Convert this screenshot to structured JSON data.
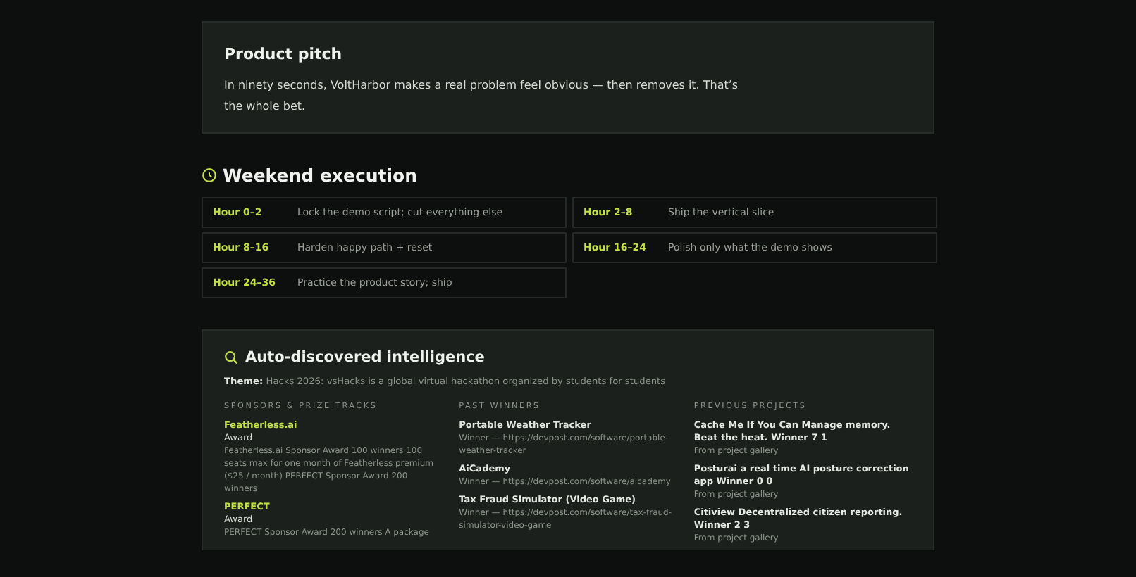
{
  "pitch": {
    "title": "Product pitch",
    "text": "In ninety seconds, VoltHarbor makes a real problem feel obvious — then removes it. That’s the whole bet."
  },
  "execution": {
    "title": "Weekend execution",
    "steps": [
      {
        "hour": "Hour 0–2",
        "task": "Lock the demo script; cut everything else"
      },
      {
        "hour": "Hour 2–8",
        "task": "Ship the vertical slice"
      },
      {
        "hour": "Hour 8–16",
        "task": "Harden happy path + reset"
      },
      {
        "hour": "Hour 16–24",
        "task": "Polish only what the demo shows"
      },
      {
        "hour": "Hour 24–36",
        "task": "Practice the product story; ship"
      }
    ]
  },
  "intelligence": {
    "title": "Auto-discovered intelligence",
    "theme_label": "Theme:",
    "theme": "Hacks 2026: vsHacks is a global virtual hackathon organized by students for students",
    "columns": [
      {
        "heading": "SPONSORS & PRIZE TRACKS",
        "kind": "sponsor",
        "items": [
          {
            "name": "Featherless.ai",
            "type": "Award",
            "detail": "Featherless.ai Sponsor Award 100 winners 100 seats max for one month of Featherless premium ($25 / month) PERFECT Sponsor Award 200 winners"
          },
          {
            "name": "PERFECT",
            "type": "Award",
            "detail": "PERFECT Sponsor Award 200 winners A package"
          }
        ]
      },
      {
        "heading": "PAST WINNERS",
        "kind": "winner",
        "items": [
          {
            "name": "Portable Weather Tracker",
            "detail": "Winner — https://devpost.com/software/portable-weather-tracker"
          },
          {
            "name": "AiCademy",
            "detail": "Winner — https://devpost.com/software/aicademy"
          },
          {
            "name": "Tax Fraud Simulator (Video Game)",
            "detail": "Winner — https://devpost.com/software/tax-fraud-simulator-video-game"
          }
        ]
      },
      {
        "heading": "PREVIOUS PROJECTS",
        "kind": "project",
        "items": [
          {
            "name": "Cache Me If You Can Manage memory. Beat the heat. Winner 7 1",
            "detail": "From project gallery"
          },
          {
            "name": "Posturai a real time AI posture correction app Winner 0 0",
            "detail": "From project gallery"
          },
          {
            "name": "Citiview Decentralized citizen reporting. Winner 2 3",
            "detail": "From project gallery"
          }
        ]
      }
    ]
  }
}
